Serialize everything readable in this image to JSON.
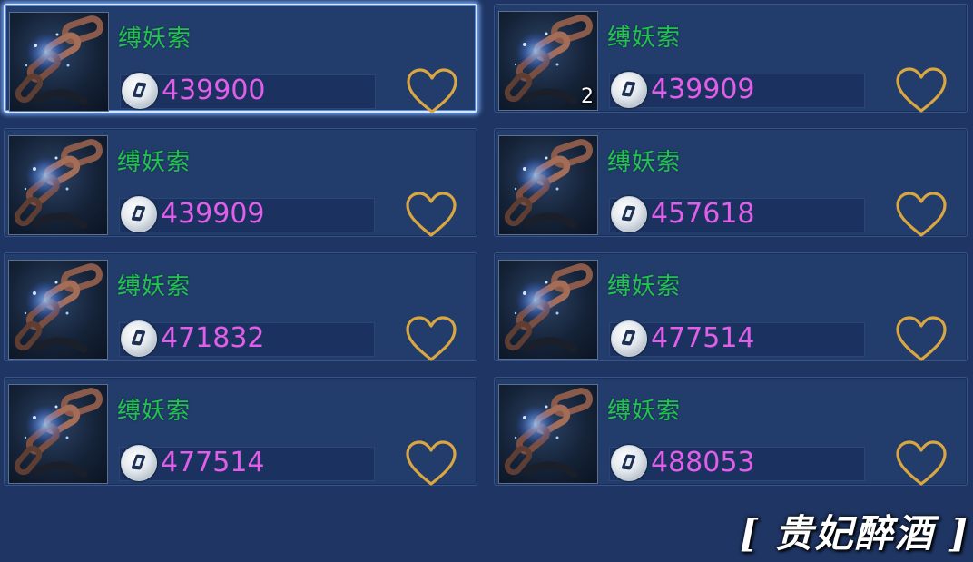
{
  "items": [
    {
      "name": "缚妖索",
      "price": "439900",
      "quantity": "",
      "selected": true
    },
    {
      "name": "缚妖索",
      "price": "439909",
      "quantity": "2",
      "selected": false
    },
    {
      "name": "缚妖索",
      "price": "439909",
      "quantity": "",
      "selected": false
    },
    {
      "name": "缚妖索",
      "price": "457618",
      "quantity": "",
      "selected": false
    },
    {
      "name": "缚妖索",
      "price": "471832",
      "quantity": "",
      "selected": false
    },
    {
      "name": "缚妖索",
      "price": "477514",
      "quantity": "",
      "selected": false
    },
    {
      "name": "缚妖索",
      "price": "477514",
      "quantity": "",
      "selected": false
    },
    {
      "name": "缚妖索",
      "price": "488053",
      "quantity": "",
      "selected": false
    }
  ],
  "icons": {
    "currency": "silver-coin-icon",
    "favorite": "heart-outline-icon",
    "item": "chain-item-icon"
  },
  "colors": {
    "item_name": "#22c24e",
    "price": "#e05ee8",
    "heart": "#d9a640",
    "background": "#1f3563"
  },
  "watermark": "[ 贵妃醉酒 ]"
}
